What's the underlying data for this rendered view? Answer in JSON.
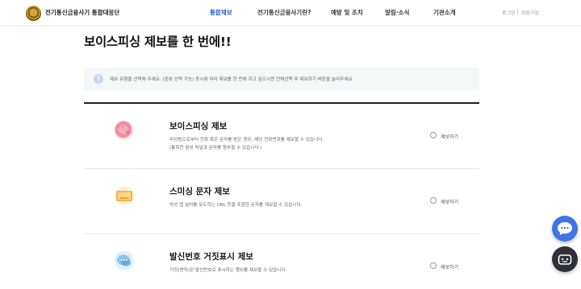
{
  "header": {
    "site_title": "전기통신금융사기 통합대응단",
    "nav": [
      "통합제보",
      "전기통신금융사기란?",
      "예방 및 조치",
      "알림·소식",
      "기관소개"
    ],
    "login": "로그인",
    "signup": "회원가입"
  },
  "main": {
    "title": "보이스피싱 제보를 한 번에!!",
    "notice": "제보 유형을 선택해 주세요. (중복 선택 가능) 동시에 여러 제보를 한 번에 하고 싶으시면 전체선택 후 제보하기 버튼을 눌러주세요",
    "notice_icon": "!",
    "items": [
      {
        "title": "보이스피싱 제보",
        "desc1": "피싱범으로부터 전화 혹은 문자를 받은 경우, 해당 전화번호를 제보할 수 있습니다.",
        "desc2": "(통화한 음성 파일과 문자를 첨부할 수 있습니다.)",
        "radio_label": "제보하기",
        "icon": "phone-call-icon"
      },
      {
        "title": "스미싱 문자 제보",
        "desc1": "악성 앱 설치를 유도하는 URL 등을 포함한 문자를 제보할 수 있습니다.",
        "desc2": "",
        "radio_label": "제보하기",
        "icon": "message-envelope-icon"
      },
      {
        "title": "발신번호 거짓표시 제보",
        "desc1": "거짓(변작)된 발신번호로 표시하는 행위를 제보할 수 있습니다.",
        "desc2": "",
        "radio_label": "제보하기",
        "icon": "speech-bubble-icon"
      }
    ]
  },
  "floating": {
    "chat_icon": "chat-dots-icon",
    "bot_icon": "chatbot-icon"
  },
  "colors": {
    "accent": "#2456c8",
    "chat_button": "#3f74e6",
    "bot_button": "#2f3136"
  }
}
